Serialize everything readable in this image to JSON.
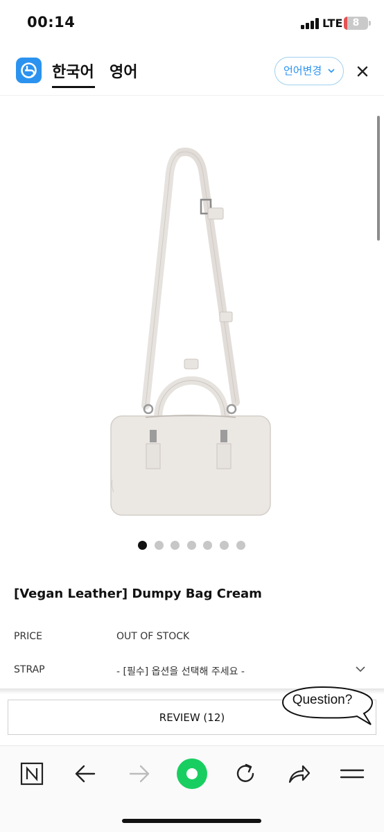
{
  "status_bar": {
    "time": "00:14",
    "network": "LTE",
    "battery": "8"
  },
  "translate_header": {
    "tabs": [
      {
        "label": "한국어",
        "active": true
      },
      {
        "label": "영어",
        "active": false
      }
    ],
    "change_language_label": "언어변경",
    "accent_color": "#2b93ef"
  },
  "product": {
    "image_count": 7,
    "active_image_index": 0,
    "title": "[Vegan Leather] Dumpy Bag Cream",
    "price_label": "PRICE",
    "price_value": "OUT OF STOCK",
    "strap_label": "STRAP",
    "strap_value": "- [필수] 옵션을 선택해 주세요 -"
  },
  "review_button_label": "REVIEW (12)",
  "question_label": "Question?",
  "toolbar": {
    "items": [
      "naver-icon",
      "back-icon",
      "forward-icon",
      "green-home-icon",
      "refresh-icon",
      "share-icon",
      "menu-icon"
    ],
    "green_color": "#19ce60"
  }
}
